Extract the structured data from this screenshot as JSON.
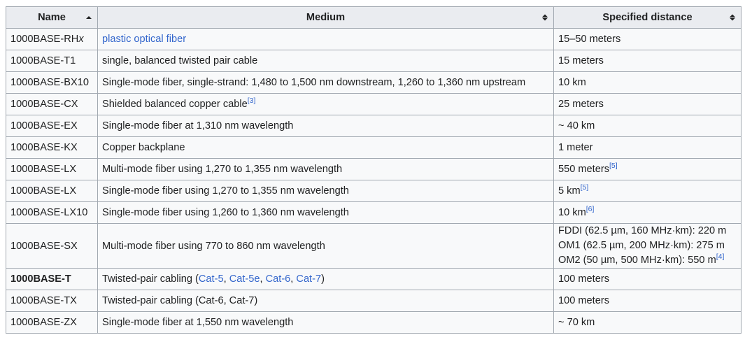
{
  "headers": {
    "name": "Name",
    "medium": "Medium",
    "distance": "Specified distance"
  },
  "rows": [
    {
      "name_main": "1000BASE-RH",
      "name_italic": "x",
      "medium_link": "plastic optical fiber",
      "distance": "15–50 meters"
    },
    {
      "name": "1000BASE-T1",
      "medium": "single, balanced twisted pair cable",
      "distance": "15 meters"
    },
    {
      "name": "1000BASE-BX10",
      "medium": "Single-mode fiber, single-strand: 1,480 to 1,500 nm downstream, 1,260 to 1,360 nm upstream",
      "distance": "10 km"
    },
    {
      "name": "1000BASE-CX",
      "medium": "Shielded balanced copper cable",
      "medium_ref": "[3]",
      "distance": "25 meters"
    },
    {
      "name": "1000BASE-EX",
      "medium": "Single-mode fiber at 1,310 nm wavelength",
      "distance": "~ 40 km"
    },
    {
      "name": "1000BASE-KX",
      "medium": "Copper backplane",
      "distance": "1 meter"
    },
    {
      "name": "1000BASE-LX",
      "medium": "Multi-mode fiber using 1,270 to 1,355 nm wavelength",
      "distance": "550 meters",
      "distance_ref": "[5]"
    },
    {
      "name": "1000BASE-LX",
      "medium": "Single-mode fiber using 1,270 to 1,355 nm wavelength",
      "distance": "5 km",
      "distance_ref": "[5]"
    },
    {
      "name": "1000BASE-LX10",
      "medium": "Single-mode fiber using 1,260 to 1,360 nm wavelength",
      "distance": "10 km",
      "distance_ref": "[6]"
    },
    {
      "name": "1000BASE-SX",
      "medium": "Multi-mode fiber using 770 to 860 nm wavelength",
      "distance_lines": [
        "FDDI (62.5 µm, 160 MHz·km): 220 m",
        "OM1 (62.5 µm, 200 MHz·km): 275 m",
        "OM2 (50 µm, 500 MHz·km): 550 m"
      ],
      "distance_ref": "[4]"
    },
    {
      "name": "1000BASE-T",
      "medium_prefix": "Twisted-pair cabling (",
      "medium_links": [
        "Cat-5",
        "Cat-5e",
        "Cat-6",
        "Cat-7"
      ],
      "medium_sep": ", ",
      "medium_suffix": ")",
      "distance": "100 meters"
    },
    {
      "name": "1000BASE-TX",
      "medium": "Twisted-pair cabling (Cat-6, Cat-7)",
      "distance": "100 meters"
    },
    {
      "name": "1000BASE-ZX",
      "medium": "Single-mode fiber at 1,550 nm wavelength",
      "distance": "~ 70 km"
    }
  ],
  "colors": {
    "link": "#3366cc",
    "header_bg": "#eaecf0",
    "cell_bg": "#f8f9fa",
    "border": "#a2a9b1",
    "text": "#202122"
  },
  "icons": {
    "name_sort": "sort-ascending-icon",
    "medium_sort": "sort-both-icon",
    "distance_sort": "sort-both-icon"
  }
}
